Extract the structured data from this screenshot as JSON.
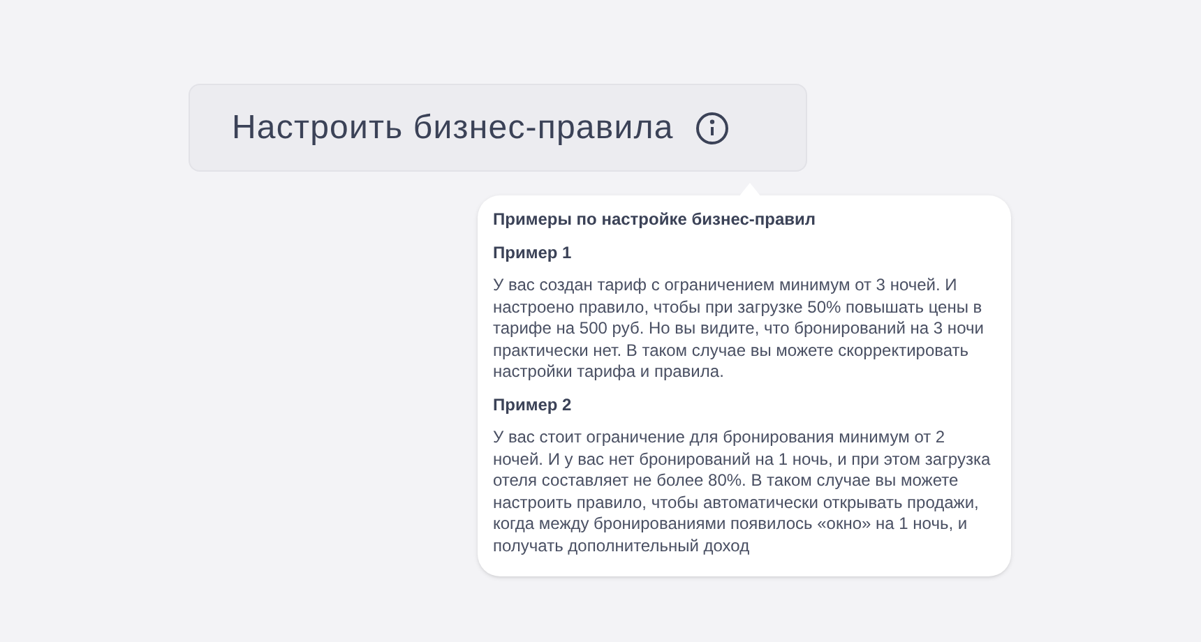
{
  "button": {
    "label": "Настроить бизнес-правила"
  },
  "tooltip": {
    "title": "Примеры по настройке бизнес-правил",
    "examples": [
      {
        "heading": "Пример 1",
        "text": "У вас создан тариф с ограничением минимум от 3 ночей. И настроено правило, чтобы при загрузке 50% повышать цены в тарифе на 500 руб. Но вы видите, что бронирований на 3 ночи практически нет. В таком случае вы можете скорректировать настройки тарифа и правила."
      },
      {
        "heading": "Пример 2",
        "text": "У вас стоит ограничение для бронирования минимум от 2 ночей. И у вас нет бронирований на 1 ночь, и при этом загрузка отеля составляет не более 80%. В таком случае вы можете настроить правило, чтобы автоматически открывать продажи, когда между бронированиями появилось «окно» на 1 ночь, и получать дополнительный доход"
      }
    ]
  }
}
